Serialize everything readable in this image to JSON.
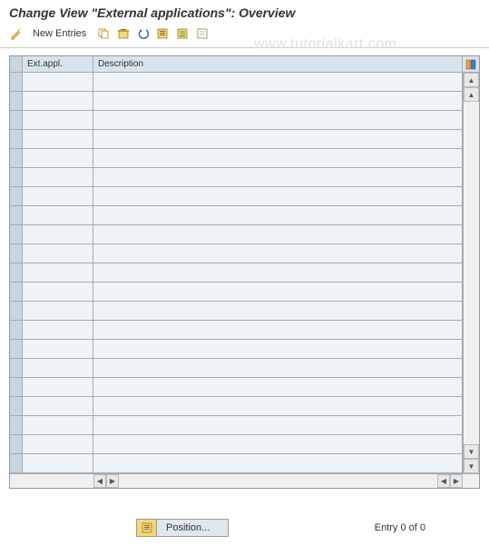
{
  "header": {
    "title": "Change View \"External applications\": Overview"
  },
  "toolbar": {
    "new_entries_label": "New Entries",
    "icons": {
      "wand": "wand-icon",
      "copy": "copy-icon",
      "delete": "delete-icon",
      "undo": "undo-icon",
      "select_all": "select-all-icon",
      "select_block": "select-block-icon",
      "deselect_all": "deselect-all-icon"
    }
  },
  "table": {
    "columns": {
      "ext_appl": "Ext.appl.",
      "description": "Description"
    },
    "row_count": 21
  },
  "footer": {
    "position_label": "Position...",
    "entry_status": "Entry 0 of 0"
  },
  "watermark": "www.tutorialkart.com"
}
